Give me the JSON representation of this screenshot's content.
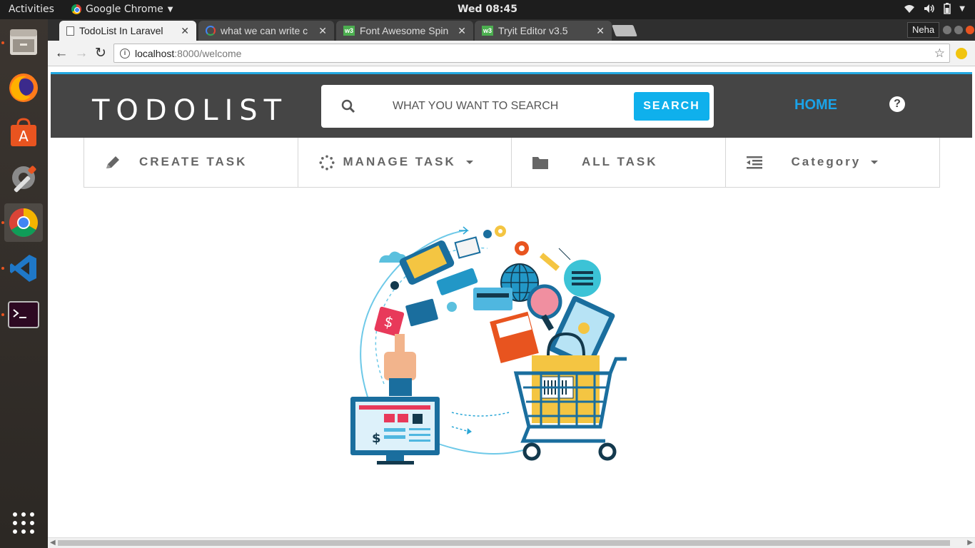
{
  "os": {
    "activities": "Activities",
    "app_name": "Google Chrome",
    "clock": "Wed 08:45"
  },
  "browser": {
    "tabs": [
      {
        "title": "TodoList In Laravel",
        "favicon": "document-icon",
        "active": true
      },
      {
        "title": "what we can write c",
        "favicon": "google-icon",
        "active": false
      },
      {
        "title": "Font Awesome Spin",
        "favicon": "w3schools-icon",
        "active": false
      },
      {
        "title": "Tryit Editor v3.5",
        "favicon": "w3schools-icon",
        "active": false
      }
    ],
    "profile": "Neha",
    "url_host": "localhost",
    "url_path": ":8000/welcome"
  },
  "site": {
    "logo": "TODOLIST",
    "search_placeholder": "WHAT YOU WANT TO SEARCH",
    "search_button": "SEARCH",
    "home_link": "HOME",
    "menu": {
      "create": "CREATE TASK",
      "manage": "MANAGE TASK",
      "all": "ALL TASK",
      "category": "Category"
    },
    "accent_color": "#0fb0ec",
    "header_color": "#454545"
  }
}
